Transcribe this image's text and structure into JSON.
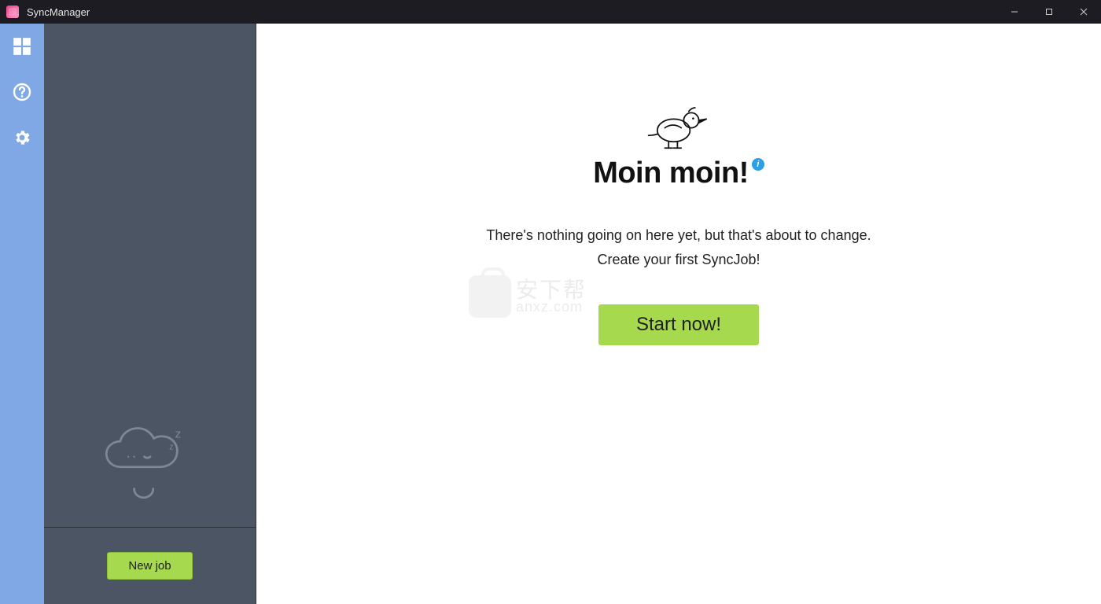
{
  "window": {
    "title": "SyncManager"
  },
  "rail": {
    "dashboard_tip": "Dashboard",
    "help_tip": "Help",
    "settings_tip": "Settings"
  },
  "sidebar": {
    "new_job_label": "New job"
  },
  "main": {
    "greeting": "Moin moin!",
    "info_char": "i",
    "line1": "There's nothing going on here yet, but that's about to change.",
    "line2": "Create your first SyncJob!",
    "start_label": "Start now!"
  },
  "watermark": {
    "cn": "安下帮",
    "en": "anxz.com"
  }
}
